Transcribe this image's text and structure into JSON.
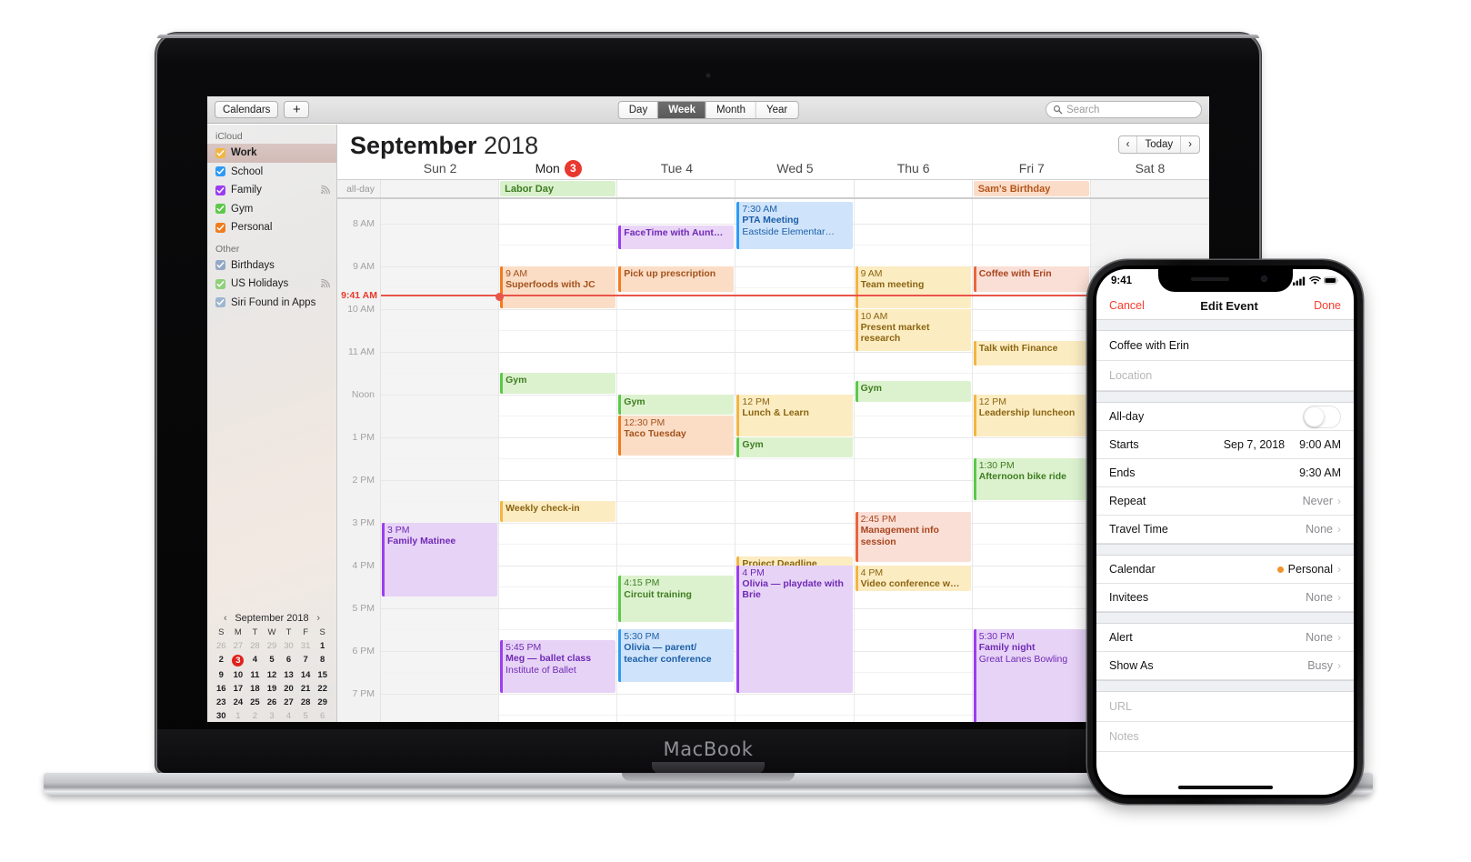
{
  "macbook": {
    "brand": "MacBook"
  },
  "toolbar": {
    "calendars_label": "Calendars",
    "add_label": "+",
    "views": [
      "Day",
      "Week",
      "Month",
      "Year"
    ],
    "active_view": "Week",
    "search_placeholder": "Search"
  },
  "sidebar": {
    "groups": [
      {
        "title": "iCloud",
        "items": [
          {
            "label": "Work",
            "color": "#f2b544",
            "checked": true,
            "selected": true,
            "shared": false
          },
          {
            "label": "School",
            "color": "#2e9bf5",
            "checked": true,
            "selected": false,
            "shared": false
          },
          {
            "label": "Family",
            "color": "#9b3ef0",
            "checked": true,
            "selected": false,
            "shared": true
          },
          {
            "label": "Gym",
            "color": "#5bc94a",
            "checked": true,
            "selected": false,
            "shared": false
          },
          {
            "label": "Personal",
            "color": "#f07c1e",
            "checked": true,
            "selected": false,
            "shared": false
          }
        ]
      },
      {
        "title": "Other",
        "items": [
          {
            "label": "Birthdays",
            "color": "#93a8c4",
            "checked": true,
            "selected": false,
            "shared": false
          },
          {
            "label": "US Holidays",
            "color": "#8fd07a",
            "checked": true,
            "selected": false,
            "shared": true
          },
          {
            "label": "Siri Found in Apps",
            "color": "#9fb6d1",
            "checked": true,
            "selected": false,
            "shared": false
          }
        ]
      }
    ],
    "mini_calendar": {
      "title": "September 2018",
      "prev": "‹",
      "next": "›",
      "dow": [
        "S",
        "M",
        "T",
        "W",
        "T",
        "F",
        "S"
      ],
      "weeks": [
        [
          {
            "d": "26",
            "m": true
          },
          {
            "d": "27",
            "m": true
          },
          {
            "d": "28",
            "m": true
          },
          {
            "d": "29",
            "m": true
          },
          {
            "d": "30",
            "m": true
          },
          {
            "d": "31",
            "m": true
          },
          {
            "d": "1",
            "m": false
          }
        ],
        [
          {
            "d": "2",
            "m": false
          },
          {
            "d": "3",
            "m": false,
            "today": true
          },
          {
            "d": "4",
            "m": false
          },
          {
            "d": "5",
            "m": false
          },
          {
            "d": "6",
            "m": false
          },
          {
            "d": "7",
            "m": false
          },
          {
            "d": "8",
            "m": false
          }
        ],
        [
          {
            "d": "9",
            "m": false
          },
          {
            "d": "10",
            "m": false
          },
          {
            "d": "11",
            "m": false
          },
          {
            "d": "12",
            "m": false
          },
          {
            "d": "13",
            "m": false
          },
          {
            "d": "14",
            "m": false
          },
          {
            "d": "15",
            "m": false
          }
        ],
        [
          {
            "d": "16",
            "m": false
          },
          {
            "d": "17",
            "m": false
          },
          {
            "d": "18",
            "m": false
          },
          {
            "d": "19",
            "m": false
          },
          {
            "d": "20",
            "m": false
          },
          {
            "d": "21",
            "m": false
          },
          {
            "d": "22",
            "m": false
          }
        ],
        [
          {
            "d": "23",
            "m": false
          },
          {
            "d": "24",
            "m": false
          },
          {
            "d": "25",
            "m": false
          },
          {
            "d": "26",
            "m": false
          },
          {
            "d": "27",
            "m": false
          },
          {
            "d": "28",
            "m": false
          },
          {
            "d": "29",
            "m": false
          }
        ],
        [
          {
            "d": "30",
            "m": false
          },
          {
            "d": "1",
            "m": true
          },
          {
            "d": "2",
            "m": true
          },
          {
            "d": "3",
            "m": true
          },
          {
            "d": "4",
            "m": true
          },
          {
            "d": "5",
            "m": true
          },
          {
            "d": "6",
            "m": true
          }
        ]
      ]
    }
  },
  "calendar": {
    "month": "September",
    "year": "2018",
    "nav": {
      "prev": "‹",
      "today": "Today",
      "next": "›"
    },
    "allday_label": "all-day",
    "days": [
      {
        "label": "Sun 2",
        "today": false,
        "badge": null,
        "dim": true
      },
      {
        "label": "Mon",
        "today": true,
        "badge": "3",
        "dim": false
      },
      {
        "label": "Tue 4",
        "today": false,
        "badge": null,
        "dim": false
      },
      {
        "label": "Wed 5",
        "today": false,
        "badge": null,
        "dim": false
      },
      {
        "label": "Thu 6",
        "today": false,
        "badge": null,
        "dim": false
      },
      {
        "label": "Fri 7",
        "today": false,
        "badge": null,
        "dim": false
      },
      {
        "label": "Sat 8",
        "today": false,
        "badge": null,
        "dim": true
      }
    ],
    "hours": [
      {
        "label": "8 AM",
        "h": 8
      },
      {
        "label": "9 AM",
        "h": 9
      },
      {
        "label": "10 AM",
        "h": 10
      },
      {
        "label": "11 AM",
        "h": 11
      },
      {
        "label": "Noon",
        "h": 12
      },
      {
        "label": "1 PM",
        "h": 13
      },
      {
        "label": "2 PM",
        "h": 14
      },
      {
        "label": "3 PM",
        "h": 15
      },
      {
        "label": "4 PM",
        "h": 16
      },
      {
        "label": "5 PM",
        "h": 17
      },
      {
        "label": "6 PM",
        "h": 18
      },
      {
        "label": "7 PM",
        "h": 19
      }
    ],
    "now": {
      "label": "9:41 AM",
      "hour": 9.68,
      "day_index": 1
    },
    "allday_events": [
      {
        "day": 1,
        "title": "Labor Day",
        "bg": "#d9f0cd",
        "fg": "#3f7d20"
      },
      {
        "day": 5,
        "title": "Sam's Birthday",
        "bg": "#fbdcc9",
        "fg": "#b5561a"
      }
    ],
    "events": [
      {
        "day": 2,
        "start": 8.05,
        "end": 8.62,
        "time": "",
        "title": "FaceTime with Aunt…",
        "loc": "",
        "bg": "#ead5f7",
        "fg": "#6f2ab5",
        "bar": "#9b3ef0"
      },
      {
        "day": 3,
        "start": 7.5,
        "end": 8.62,
        "time": "7:30 AM",
        "title": "PTA Meeting",
        "loc": "Eastside Elementar…",
        "bg": "#cfe4fb",
        "fg": "#1d5fa8",
        "bar": "#2e9bf5"
      },
      {
        "day": 1,
        "start": 9.0,
        "end": 10.0,
        "time": "9 AM",
        "title": "Superfoods with JC",
        "loc": "",
        "bg": "#fbddc6",
        "fg": "#a2521b",
        "bar": "#f07c1e"
      },
      {
        "day": 2,
        "start": 9.0,
        "end": 9.62,
        "time": "",
        "title": "Pick up prescription",
        "loc": "",
        "bg": "#fbddc6",
        "fg": "#a2521b",
        "bar": "#f07c1e"
      },
      {
        "day": 4,
        "start": 9.0,
        "end": 10.0,
        "time": "9 AM",
        "title": "Team meeting",
        "loc": "",
        "bg": "#fcecc2",
        "fg": "#8a6512",
        "bar": "#f2b544"
      },
      {
        "day": 5,
        "start": 9.0,
        "end": 9.62,
        "time": "",
        "title": "Coffee with Erin",
        "loc": "",
        "bg": "#fadfd6",
        "fg": "#a8451f",
        "bar": "#e8663c"
      },
      {
        "day": 4,
        "start": 10.0,
        "end": 11.0,
        "time": "10 AM",
        "title": "Present market research",
        "loc": "",
        "bg": "#fcecc2",
        "fg": "#8a6512",
        "bar": "#f2b544"
      },
      {
        "day": 5,
        "start": 10.75,
        "end": 11.35,
        "time": "",
        "title": "Talk with Finance",
        "loc": "",
        "bg": "#fcecc2",
        "fg": "#8a6512",
        "bar": "#f2b544"
      },
      {
        "day": 1,
        "start": 11.5,
        "end": 12.0,
        "time": "",
        "title": "Gym",
        "loc": "",
        "bg": "#dcf2cf",
        "fg": "#3f7d20",
        "bar": "#5bc94a"
      },
      {
        "day": 2,
        "start": 12.0,
        "end": 12.5,
        "time": "",
        "title": "Gym",
        "loc": "",
        "bg": "#dcf2cf",
        "fg": "#3f7d20",
        "bar": "#5bc94a"
      },
      {
        "day": 4,
        "start": 11.7,
        "end": 12.2,
        "time": "",
        "title": "Gym",
        "loc": "",
        "bg": "#dcf2cf",
        "fg": "#3f7d20",
        "bar": "#5bc94a"
      },
      {
        "day": 2,
        "start": 12.5,
        "end": 13.45,
        "time": "12:30 PM",
        "title": "Taco Tuesday",
        "loc": "",
        "bg": "#fbddc6",
        "fg": "#a2521b",
        "bar": "#f07c1e"
      },
      {
        "day": 3,
        "start": 12.0,
        "end": 13.0,
        "time": "12 PM",
        "title": "Lunch & Learn",
        "loc": "",
        "bg": "#fcecc2",
        "fg": "#8a6512",
        "bar": "#f2b544"
      },
      {
        "day": 3,
        "start": 13.0,
        "end": 13.5,
        "time": "",
        "title": "Gym",
        "loc": "",
        "bg": "#dcf2cf",
        "fg": "#3f7d20",
        "bar": "#5bc94a"
      },
      {
        "day": 5,
        "start": 12.0,
        "end": 13.0,
        "time": "12 PM",
        "title": "Leadership luncheon",
        "loc": "",
        "bg": "#fcecc2",
        "fg": "#8a6512",
        "bar": "#f2b544"
      },
      {
        "day": 5,
        "start": 13.5,
        "end": 14.5,
        "time": "1:30 PM",
        "title": "Afternoon bike ride",
        "loc": "",
        "bg": "#dcf2cf",
        "fg": "#3f7d20",
        "bar": "#5bc94a"
      },
      {
        "day": 1,
        "start": 14.5,
        "end": 15.0,
        "time": "",
        "title": "Weekly check-in",
        "loc": "",
        "bg": "#fcecc2",
        "fg": "#8a6512",
        "bar": "#f2b544"
      },
      {
        "day": 0,
        "start": 15.0,
        "end": 16.75,
        "time": "3 PM",
        "title": "Family Matinee",
        "loc": "",
        "bg": "#e7d3f6",
        "fg": "#6f2ab5",
        "bar": "#9b3ef0"
      },
      {
        "day": 4,
        "start": 14.75,
        "end": 15.95,
        "time": "2:45 PM",
        "title": "Management info session",
        "loc": "",
        "bg": "#fadfd6",
        "fg": "#a8451f",
        "bar": "#e8663c"
      },
      {
        "day": 3,
        "start": 15.8,
        "end": 16.0,
        "time": "",
        "title": "Project Deadline",
        "loc": "",
        "bg": "#fcecc2",
        "fg": "#8a6512",
        "bar": "#f2b544"
      },
      {
        "day": 3,
        "start": 16.0,
        "end": 19.0,
        "time": "4 PM",
        "title": "Olivia — playdate with Brie",
        "loc": "",
        "bg": "#e7d3f6",
        "fg": "#6f2ab5",
        "bar": "#9b3ef0"
      },
      {
        "day": 4,
        "start": 16.0,
        "end": 16.62,
        "time": "4 PM",
        "title": "Video conference w…",
        "loc": "",
        "bg": "#fcecc2",
        "fg": "#8a6512",
        "bar": "#f2b544"
      },
      {
        "day": 2,
        "start": 16.25,
        "end": 17.35,
        "time": "4:15 PM",
        "title": "Circuit training",
        "loc": "",
        "bg": "#dcf2cf",
        "fg": "#3f7d20",
        "bar": "#5bc94a"
      },
      {
        "day": 2,
        "start": 17.5,
        "end": 18.75,
        "time": "5:30 PM",
        "title": "Olivia — parent/ teacher conference",
        "loc": "",
        "bg": "#cfe4fb",
        "fg": "#1d5fa8",
        "bar": "#2e9bf5"
      },
      {
        "day": 1,
        "start": 17.75,
        "end": 19.0,
        "time": "5:45 PM",
        "title": "Meg — ballet class",
        "loc": "Institute of Ballet",
        "bg": "#e7d3f6",
        "fg": "#6f2ab5",
        "bar": "#9b3ef0"
      },
      {
        "day": 5,
        "start": 17.5,
        "end": 20.0,
        "time": "5:30 PM",
        "title": "Family night",
        "loc": "Great Lanes Bowling",
        "bg": "#e7d3f6",
        "fg": "#6f2ab5",
        "bar": "#9b3ef0"
      }
    ]
  },
  "iphone": {
    "status": {
      "time": "9:41"
    },
    "nav": {
      "cancel": "Cancel",
      "title": "Edit Event",
      "done": "Done"
    },
    "fields": {
      "event_title": "Coffee with Erin",
      "location_placeholder": "Location",
      "allday_label": "All-day",
      "starts_label": "Starts",
      "starts_date": "Sep 7, 2018",
      "starts_time": "9:00 AM",
      "ends_label": "Ends",
      "ends_time": "9:30 AM",
      "repeat_label": "Repeat",
      "repeat_value": "Never",
      "travel_label": "Travel Time",
      "travel_value": "None",
      "calendar_label": "Calendar",
      "calendar_value": "Personal",
      "calendar_color": "#f0932b",
      "invitees_label": "Invitees",
      "invitees_value": "None",
      "alert_label": "Alert",
      "alert_value": "None",
      "showas_label": "Show As",
      "showas_value": "Busy",
      "url_placeholder": "URL",
      "notes_placeholder": "Notes",
      "chevron": "›"
    }
  }
}
